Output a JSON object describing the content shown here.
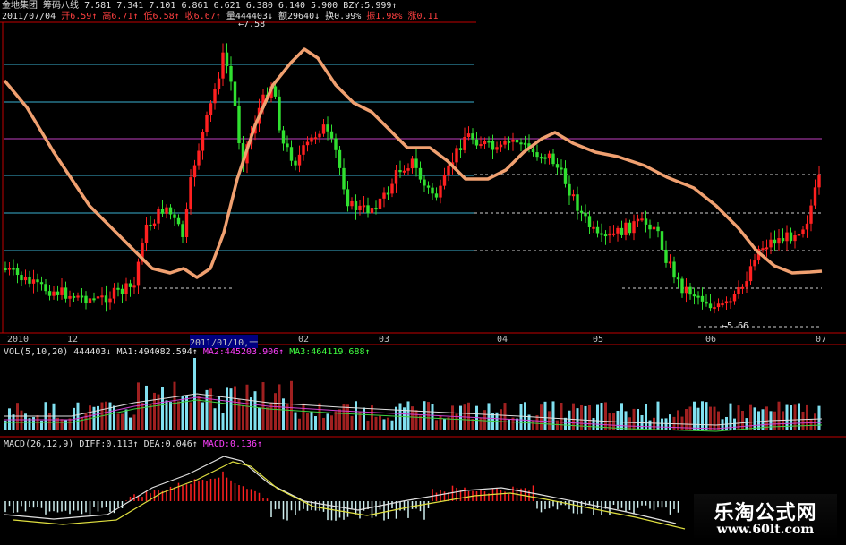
{
  "header": {
    "stock_name": "金地集团",
    "indicator_name": "筹码八线",
    "values": [
      "7.581",
      "7.341",
      "7.101",
      "6.861",
      "6.621",
      "6.380",
      "6.140",
      "5.900"
    ],
    "bzy_label": "BZY:",
    "bzy_value": "5.999↑",
    "date": "2011/07/04",
    "open_label": "开",
    "open_value": "6.59↑",
    "high_label": "高",
    "high_value": "6.71↑",
    "low_label": "低",
    "low_value": "6.58↑",
    "close_label": "收",
    "close_value": "6.67↑",
    "volume_label": "量",
    "volume_value": "444403↓",
    "amount_label": "额",
    "amount_value": "29640↓",
    "turnover_label": "换",
    "turnover_value": "0.99%",
    "amplitude_label": "振",
    "amplitude_value": "1.98%",
    "change_label": "涨",
    "change_value": "0.11"
  },
  "price_annotations": {
    "high_mark": "7.58",
    "low_mark": "5.66"
  },
  "x_axis": {
    "labels": [
      "2010",
      "12",
      "2011/01/10,一",
      "02",
      "03",
      "04",
      "05",
      "06",
      "07"
    ],
    "selected": "2011/01/10,一"
  },
  "volume_panel": {
    "title": "VOL(5,10,20)",
    "value": "444403↓",
    "ma1_label": "MA1:",
    "ma1_value": "494082.594↑",
    "ma2_label": "MA2:",
    "ma2_value": "445203.906↑",
    "ma3_label": "MA3:",
    "ma3_value": "464119.688↑"
  },
  "macd_panel": {
    "title": "MACD(26,12,9)",
    "diff_label": "DIFF:",
    "diff_value": "0.113↑",
    "dea_label": "DEA:",
    "dea_value": "0.046↑",
    "macd_label": "MACD:",
    "macd_value": "0.136↑"
  },
  "watermark": {
    "title": "乐淘公式网",
    "url": "www.60lt.com"
  },
  "colors": {
    "up": "#ff2020",
    "down": "#30e030",
    "ma_line": "#f0a070",
    "vol_up": "#a02020",
    "vol_down": "#80e0f0",
    "grid_cyan": "#3ab0d0",
    "grid_magenta": "#c040c0",
    "panel_border": "#c00000"
  }
}
